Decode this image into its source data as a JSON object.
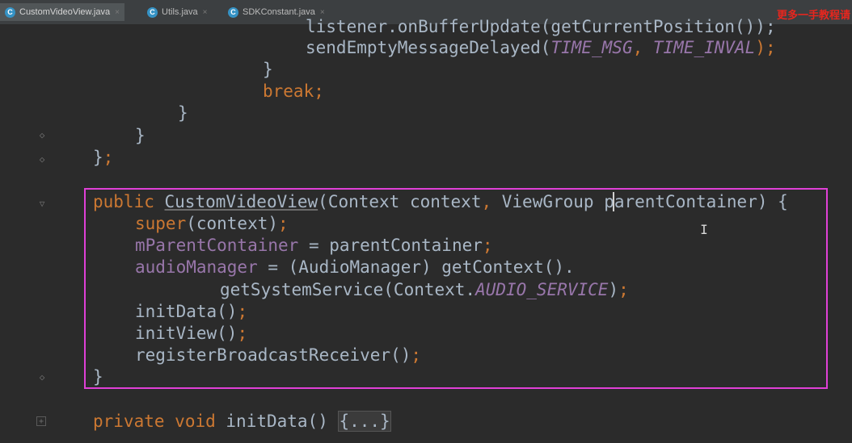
{
  "tabs": [
    {
      "label": "CustomVideoView.java",
      "icon": "C",
      "active": true
    },
    {
      "label": "Utils.java",
      "icon": "C"
    },
    {
      "label": "SDKConstant.java",
      "icon": "C"
    }
  ],
  "watermark": "更多一手教程请",
  "code": {
    "l1": "listener.onBufferUpdate(getCurrentPosition());",
    "l2_method": "sendEmptyMessageDelayed(",
    "l2_c1": "TIME_MSG",
    "l2_sep": ", ",
    "l2_c2": "TIME_INVAL",
    "l2_end": ");",
    "brace_close": "}",
    "break_kw": "break",
    "semi": ";",
    "public_kw": "public",
    "ctor_name": "CustomVideoView",
    "ctor_params_a": "(Context context",
    "comma": ",",
    "ctor_params_b": " ViewGroup parentContainer) {",
    "super_kw": "super",
    "super_args": "(context)",
    "field1": "mParentContainer",
    "assign1": " = parentContainer",
    "field2": "audioManager",
    "assign2": " = (AudioManager) getContext().",
    "getsys": "getSystemService(Context.",
    "audio_const": "AUDIO_SERVICE",
    "close_paren": ")",
    "init_data_call": "initData()",
    "init_view_call": "initView()",
    "register_call": "registerBroadcastReceiver()",
    "private_kw": "private",
    "void_kw": "void",
    "init_data_sig": "initData() ",
    "folded_body": "{...}"
  }
}
